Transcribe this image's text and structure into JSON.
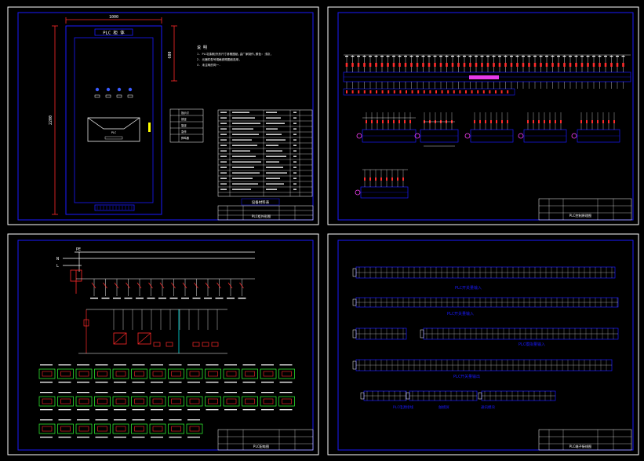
{
  "colors": {
    "background": "#000000",
    "frame": "#ffffff",
    "border": "#1a1aff",
    "wire": "#ffffff",
    "breaker": "#ff2a2a",
    "magenta": "#ff40ff",
    "green": "#33ff33",
    "yellow": "#ffff00",
    "cyan": "#00ffff"
  },
  "sheet1": {
    "cabinet_label": "PLC 柜 体",
    "dim_width": "1000",
    "dim_height": "2200",
    "dim_side": "600",
    "notes_title": "说  明",
    "notes": [
      "1. PLC控制柜外形尺寸参照图纸,由厂家制作,颜色: 浅灰,",
      "2. 元器件型号规格参照图纸选用,",
      "3. 未注明的同一."
    ],
    "plc_screen_label": "PLC",
    "legend_rows": [
      "指示灯",
      "按钮",
      "旋钮",
      "急停",
      "蜂鸣器"
    ],
    "table_title": "设备材料表",
    "title_block_name": "PLC柜外形图"
  },
  "sheet2": {
    "title_block_name": "PLC控制原理图"
  },
  "sheet3": {
    "pe_label": "PE",
    "n_label": "N",
    "l_label": "L",
    "title_block_name": "PLC配电图"
  },
  "sheet4": {
    "captions": [
      "PLC开关量输入",
      "PLC开关量输入",
      "PLC模拟量输入",
      "PLC开关量输出",
      "PLC电源接线",
      "触摸屏",
      "通讯模块"
    ],
    "title_block_name": "PLC端子接线图"
  }
}
